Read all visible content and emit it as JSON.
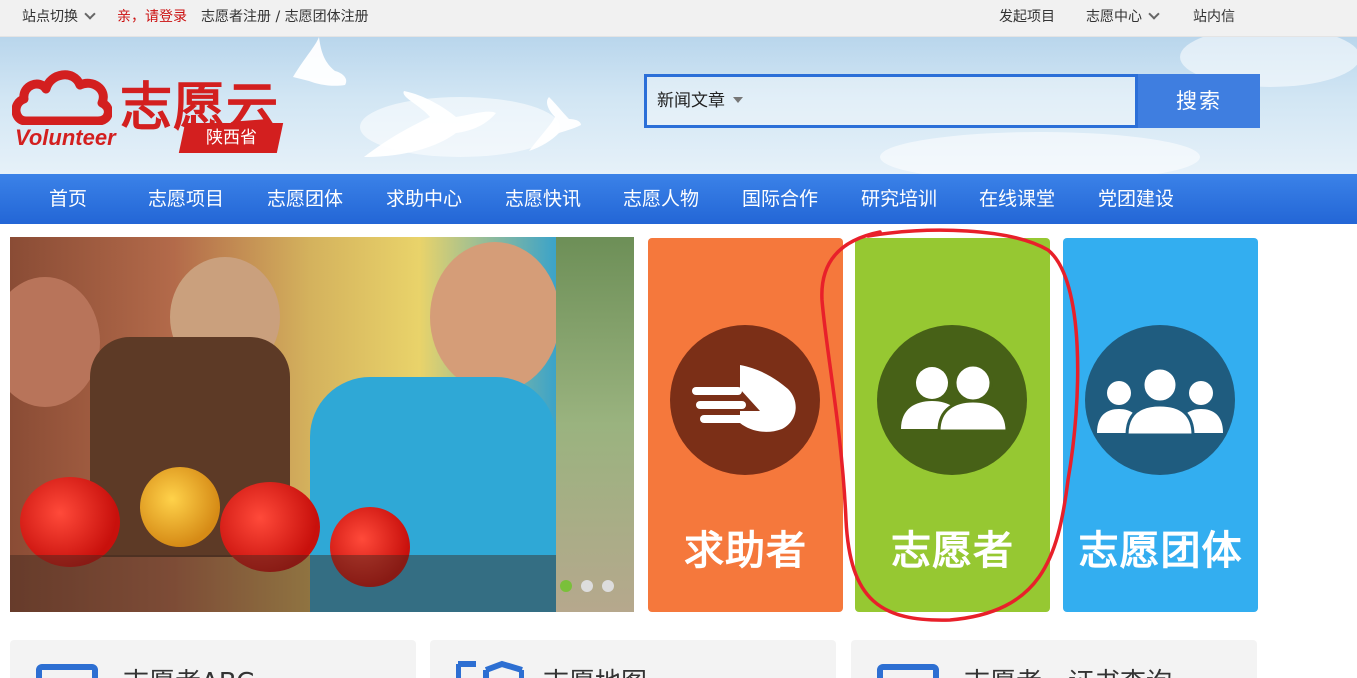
{
  "topbar": {
    "site_switch": "站点切换",
    "login": "亲，请登录",
    "register": "志愿者注册 / 志愿团体注册",
    "launch_project": "发起项目",
    "volunteer_center": "志愿中心",
    "inbox": "站内信"
  },
  "logo": {
    "title": "志愿云",
    "english": "Volunteer",
    "province": "陕西省",
    "color": "#d31f1f"
  },
  "search": {
    "type_selected": "新闻文章",
    "button_label": "搜索",
    "accent": "#2b6fd8"
  },
  "nav": {
    "items": [
      "首页",
      "志愿项目",
      "志愿团体",
      "求助中心",
      "志愿快讯",
      "志愿人物",
      "国际合作",
      "研究培训",
      "在线课堂",
      "党团建设"
    ]
  },
  "carousel": {
    "slide_count": 3,
    "active_index": 0
  },
  "tiles": [
    {
      "label": "求助者",
      "bg": "#f5783c",
      "circle": "#7b2f17",
      "icon": "handshake-icon"
    },
    {
      "label": "志愿者",
      "bg": "#96c832",
      "circle": "#476117",
      "icon": "two-people-icon"
    },
    {
      "label": "志愿团体",
      "bg": "#33aef0",
      "circle": "#1f5c7f",
      "icon": "group-icon"
    }
  ],
  "cards": [
    {
      "title": "志愿者ABC",
      "icon": "monitor-icon"
    },
    {
      "title": "志愿地图",
      "icon": "map-icon"
    },
    {
      "title": "志愿者、证书查询",
      "icon": "certificate-icon"
    }
  ],
  "annotation": {
    "color": "#e8202a",
    "shape": "hand-drawn-oval-around-volunteer-tile"
  }
}
